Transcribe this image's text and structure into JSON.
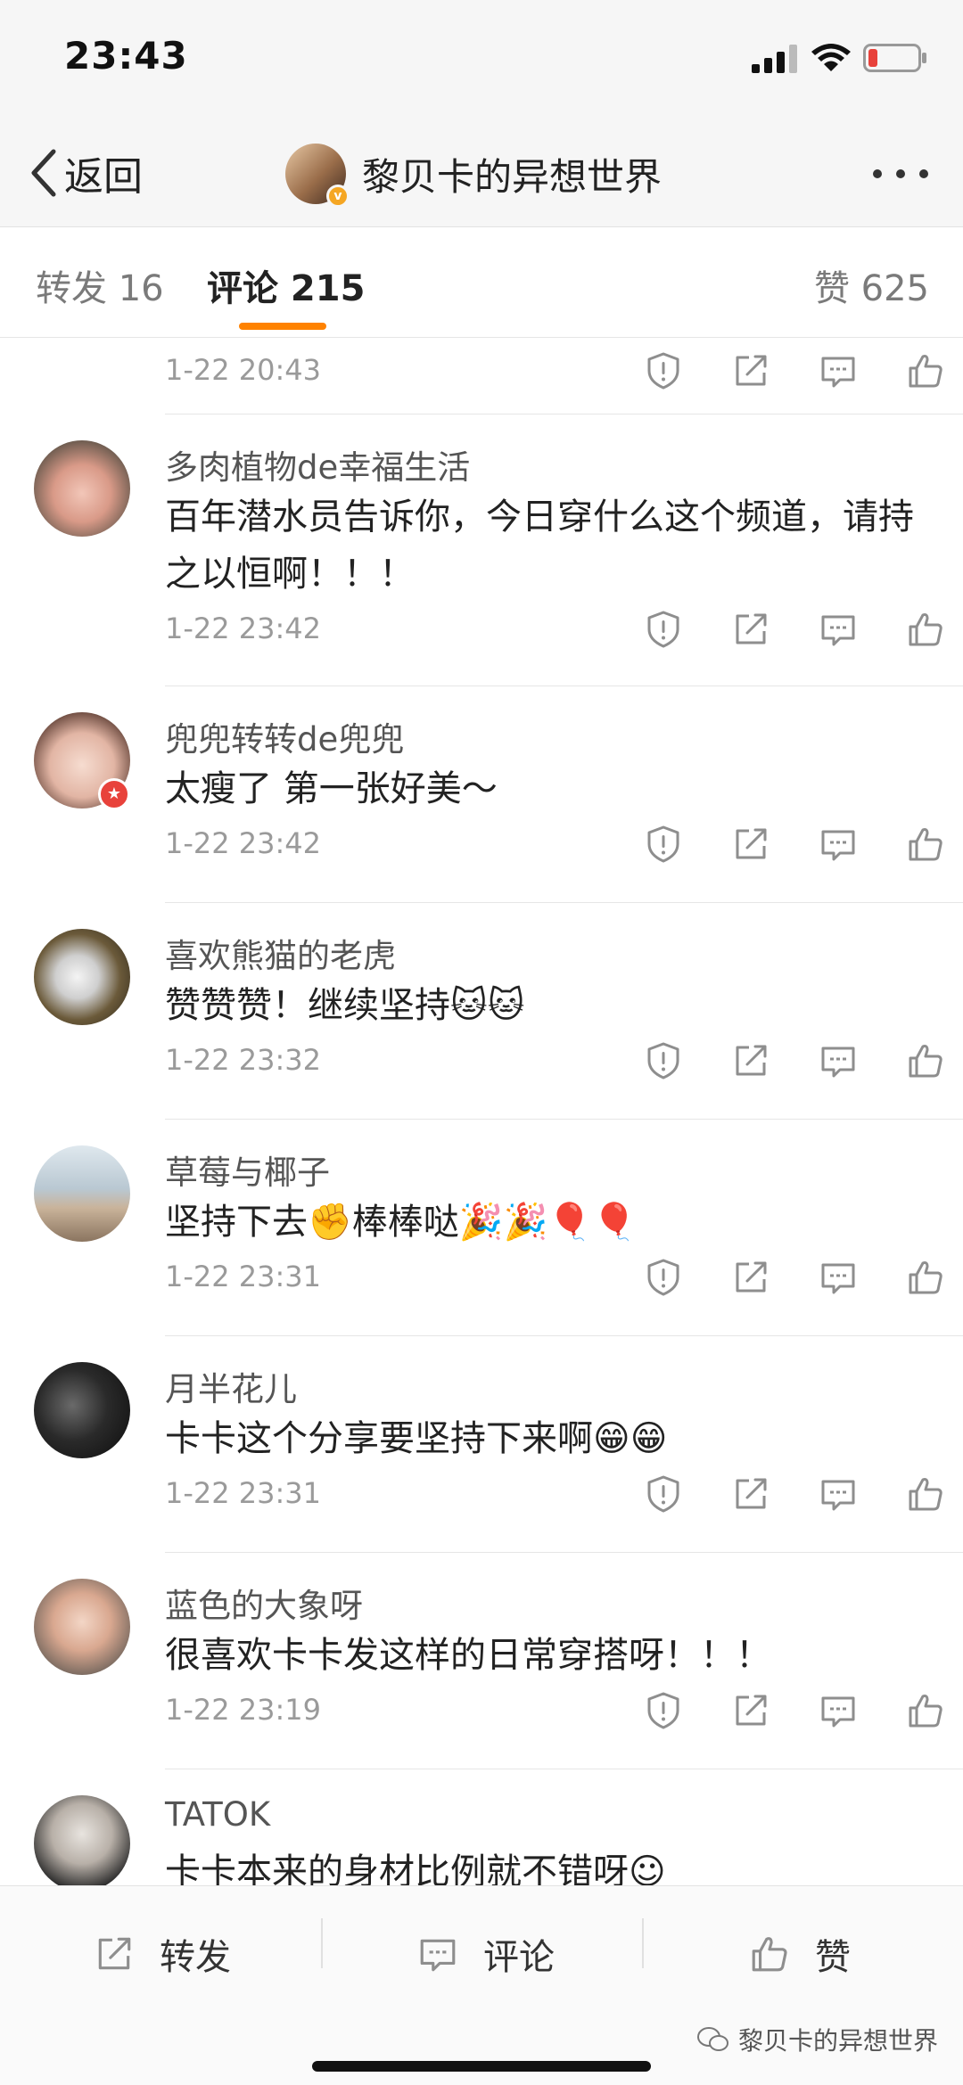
{
  "status_bar": {
    "time": "23:43"
  },
  "nav": {
    "back_label": "返回",
    "title": "黎贝卡的异想世界"
  },
  "tabs": {
    "repost": "转发 16",
    "comment": "评论 215",
    "like": "赞 625"
  },
  "first_row": {
    "time": "1-22 20:43"
  },
  "comments": [
    {
      "user": "多肉植物de幸福生活",
      "text": "百年潜水员告诉你，今日穿什么这个频道，请持之以恒啊！！！",
      "time": "1-22 23:42"
    },
    {
      "user": "兜兜转转de兜兜",
      "text": "太瘦了 第一张好美～",
      "time": "1-22 23:42"
    },
    {
      "user": "喜欢熊猫的老虎",
      "text": "赞赞赞！继续坚持🐱🐱",
      "time": "1-22 23:32"
    },
    {
      "user": "草莓与椰子",
      "text": "坚持下去✊棒棒哒🎉🎉🎈🎈",
      "time": "1-22 23:31"
    },
    {
      "user": "月半花儿",
      "text": "卡卡这个分享要坚持下来啊😁😁",
      "time": "1-22 23:31"
    },
    {
      "user": "蓝色的大象呀",
      "text": "很喜欢卡卡发这样的日常穿搭呀！！！",
      "time": "1-22 23:19"
    },
    {
      "user": "TATOK",
      "text": "卡卡本来的身材比例就不错呀☺",
      "time": ""
    }
  ],
  "bottom_bar": {
    "repost": "转发",
    "comment": "评论",
    "like": "赞",
    "watermark": "黎贝卡的异想世界"
  },
  "icons": {
    "back": "chevron-left-icon",
    "more": "more-dots-icon",
    "report": "report-icon",
    "share": "share-icon",
    "reply": "comment-icon",
    "like": "thumbs-up-icon"
  },
  "colors": {
    "accent": "#ff8200",
    "verified": "#f5a623",
    "badge_red": "#e8423b",
    "muted_text": "#9a9a9a",
    "icon_gray": "#8e8e8e"
  }
}
